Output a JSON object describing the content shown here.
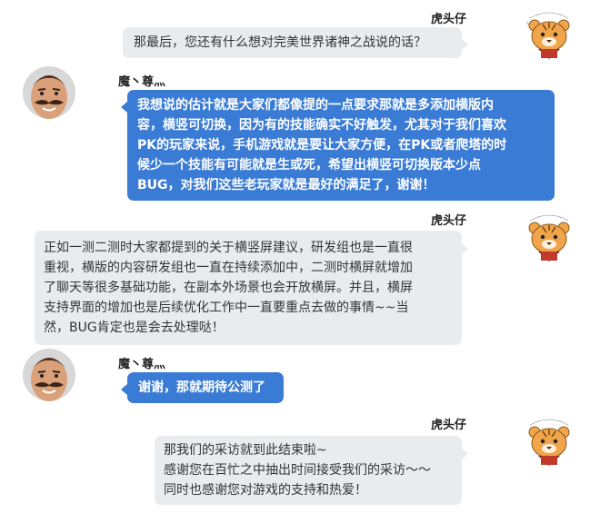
{
  "speakers": {
    "interviewer": "虎头仔",
    "player": "魔丶尊灬"
  },
  "messages": [
    {
      "speaker": "interviewer",
      "lines": [
        "那最后，您还有什么想对完美世界诸神之战说的话？"
      ]
    },
    {
      "speaker": "player",
      "lines": [
        "我想说的估计就是大家们都像提的一点要求那就是多添加横版内",
        "容，横竖可切换，因为有的技能确实不好触发，尤其对于我们喜欢",
        "PK的玩家来说，手机游戏就是要让大家方便，在PK或者爬塔的时",
        "候少一个技能有可能就是生或死，希望出横竖可切换版本少点",
        "BUG，对我们这些老玩家就是最好的满足了，谢谢！"
      ]
    },
    {
      "speaker": "interviewer",
      "lines": [
        "正如一测二测时大家都提到的关于横竖屏建议，研发组也是一直很",
        "重视，横版的内容研发组也一直在持续添加中，二测时横屏就增加",
        "了聊天等很多基础功能，在副本外场景也会开放横屏。并且，横屏",
        "支持界面的增加也是后续优化工作中一直要重点去做的事情~~当",
        "然，BUG肯定也是会去处理哒！"
      ]
    },
    {
      "speaker": "player",
      "lines": [
        "谢谢，那就期待公测了"
      ]
    },
    {
      "speaker": "interviewer",
      "lines": [
        "那我们的采访就到此结束啦~",
        "感谢您在百忙之中抽出时间接受我们的采访～～",
        "同时也感谢您对游戏的支持和热爱！"
      ]
    }
  ],
  "colors": {
    "player_bubble": "#3a7bd5",
    "interviewer_bubble": "#e9ecef",
    "tiger_orange": "#f0a54a"
  }
}
